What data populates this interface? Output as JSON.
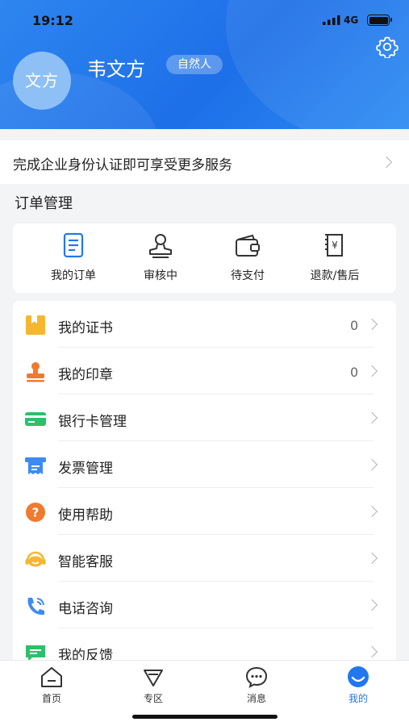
{
  "status": {
    "time": "19:12",
    "network": "4G"
  },
  "profile": {
    "avatar_text": "文方",
    "name": "韦文方",
    "badge": "自然人",
    "settings_icon": "gear-icon"
  },
  "banner": {
    "text": "完成企业身份认证即可享受更多服务"
  },
  "orders": {
    "title": "订单管理",
    "items": [
      {
        "label": "我的订单",
        "icon": "order-list-icon"
      },
      {
        "label": "审核中",
        "icon": "stamp-review-icon"
      },
      {
        "label": "待支付",
        "icon": "wallet-icon"
      },
      {
        "label": "退款/售后",
        "icon": "refund-icon"
      }
    ]
  },
  "menu": {
    "items": [
      {
        "label": "我的证书",
        "count": "0",
        "icon": "certificate-icon",
        "color": "#f5b731"
      },
      {
        "label": "我的印章",
        "count": "0",
        "icon": "seal-icon",
        "color": "#f07a2e"
      },
      {
        "label": "银行卡管理",
        "count": "",
        "icon": "bank-card-icon",
        "color": "#2fbf6a"
      },
      {
        "label": "发票管理",
        "count": "",
        "icon": "invoice-icon",
        "color": "#3d8bf0"
      },
      {
        "label": "使用帮助",
        "count": "",
        "icon": "help-icon",
        "color": "#f07a2e"
      },
      {
        "label": "智能客服",
        "count": "",
        "icon": "customer-service-icon",
        "color": "#f5b731"
      },
      {
        "label": "电话咨询",
        "count": "",
        "icon": "phone-icon",
        "color": "#3d8bf0"
      },
      {
        "label": "我的反馈",
        "count": "",
        "icon": "feedback-icon",
        "color": "#2fbf6a"
      }
    ]
  },
  "tabs": [
    {
      "label": "首页",
      "icon": "home-icon",
      "active": false
    },
    {
      "label": "专区",
      "icon": "diamond-icon",
      "active": false
    },
    {
      "label": "消息",
      "icon": "message-icon",
      "active": false
    },
    {
      "label": "我的",
      "icon": "profile-icon",
      "active": true
    }
  ],
  "colors": {
    "primary": "#2277ee",
    "header_start": "#2e86f0",
    "header_end": "#1e6fe8"
  }
}
